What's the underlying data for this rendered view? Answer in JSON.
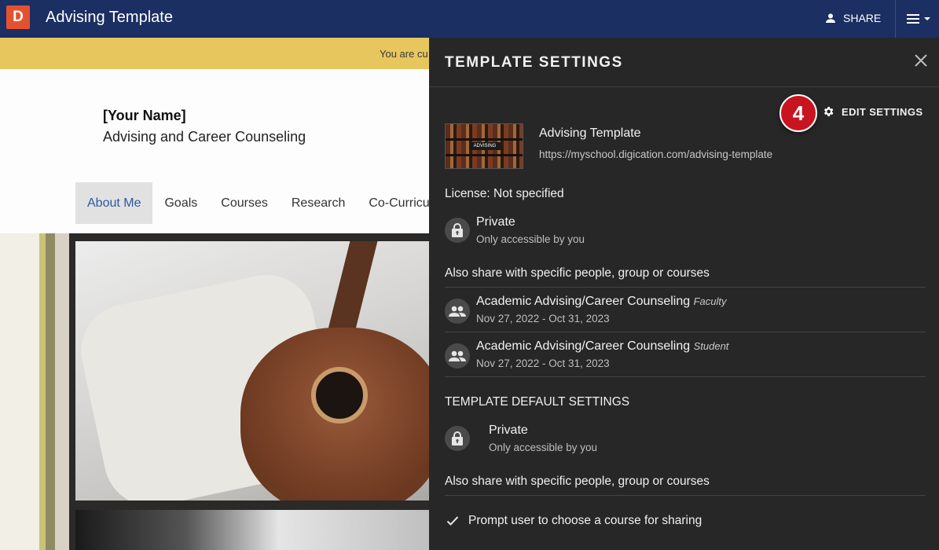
{
  "topbar": {
    "logo_letter": "D",
    "title": "Advising Template",
    "share_label": "SHARE"
  },
  "page": {
    "banner_text": "You are cu",
    "name": "[Your Name]",
    "subtitle": "Advising and Career Counseling",
    "nav": [
      {
        "label": "About Me"
      },
      {
        "label": "Goals"
      },
      {
        "label": "Courses"
      },
      {
        "label": "Research"
      },
      {
        "label": "Co-Curricu"
      }
    ]
  },
  "panel": {
    "title": "TEMPLATE SETTINGS",
    "step_number": "4",
    "edit_settings_label": "EDIT SETTINGS",
    "template_name": "Advising Template",
    "template_url": "https://myschool.digication.com/advising-template",
    "thumbnail_label": "ADVISING",
    "license": "License: Not specified",
    "privacy": {
      "title": "Private",
      "subtitle": "Only accessible by you"
    },
    "share_heading": "Also share with specific people, group or courses",
    "shares": [
      {
        "name": "Academic Advising/Career Counseling",
        "role": "Faculty",
        "dates": "Nov 27, 2022 - Oct 31, 2023"
      },
      {
        "name": "Academic Advising/Career Counseling",
        "role": "Student",
        "dates": "Nov 27, 2022 - Oct 31, 2023"
      }
    ],
    "defaults_heading": "TEMPLATE DEFAULT SETTINGS",
    "default_privacy": {
      "title": "Private",
      "subtitle": "Only accessible by you"
    },
    "default_share_heading": "Also share with specific people, group or courses",
    "prompt_label": "Prompt user to choose a course for sharing"
  }
}
